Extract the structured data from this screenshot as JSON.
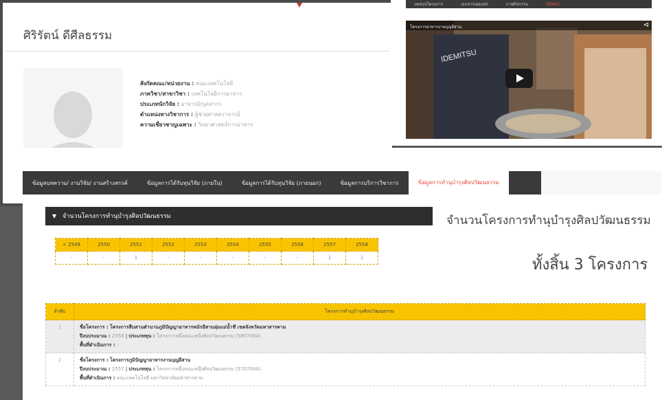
{
  "profile": {
    "name": "ศิริรัตน์ ดีศีลธรรม",
    "fields": [
      {
        "label": "สังกัดคณะ/หน่วยงาน :",
        "value": "คณะเทคโนโลยี"
      },
      {
        "label": "ภาควิชา/สาขาวิชา :",
        "value": "เทคโนโลยีการอาหาร"
      },
      {
        "label": "ประเภทนักวิจัย :",
        "value": "อาจารย์/บุคลากร"
      },
      {
        "label": "ตำแหน่งทางวิชาการ :",
        "value": "ผู้ช่วยศาสตราจารย์"
      },
      {
        "label": "ความเชี่ยวชาญเฉพาะ :",
        "value": "วิทยาศาสตร์การอาหาร"
      }
    ]
  },
  "topnav": {
    "items": [
      "บทสรุปโครงการ",
      "เอกสารเผยแพร่",
      "ภาพกิจกรรม",
      "วิดีทัศน์"
    ]
  },
  "video": {
    "title": "โครงการอาหารงานบุญอีสาน",
    "brand_text": "IDEMITSU"
  },
  "tabs": [
    "ข้อมูลบทความ/ งานวิจัย/ งานสร้างสรรค์",
    "ข้อมูลการได้รับทุนวิจัย (ภายใน)",
    "ข้อมูลการได้รับทุนวิจัย (ภายนอก)",
    "ข้อมูลการบริการวิชาการ",
    "ข้อมูลการทำนุบำรุงศิลปวัฒนธรรม"
  ],
  "accordion_title": "จำนวนโครงการทำนุบำรุงศิลปวัฒนธรรม",
  "years": [
    "< 2549",
    "2550",
    "2551",
    "2552",
    "2553",
    "2554",
    "2555",
    "2556",
    "2557",
    "2558"
  ],
  "year_counts": [
    "-",
    "-",
    "1",
    "-",
    "-",
    "-",
    "-",
    "-",
    "1",
    "1"
  ],
  "summary": {
    "title": "จำนวนโครงการทำนุบำรุงศิลปวัฒนธรรม",
    "count_text": "ทั้งสิ้น 3 โครงการ"
  },
  "projects_table": {
    "col_no": "ลำดับ",
    "col_title": "โครงการทำนุบำรุงศิลปวัฒนธรรม",
    "label_name": "ชื่อโครงการ :",
    "label_year": "ปีงบประมาณ :",
    "label_fund": "ประเภททุน :",
    "label_area": "พื้นที่ดำเนินการ :",
    "rows": [
      {
        "no": "1",
        "name": "โครงการสืบสานตำนานภูมิปัญญาอาหารหมักอีสานลุ่มแม่น้ำชี เขตจังหวัดมหาสารคาม",
        "year": "2558",
        "fund": "โครงการหนึ่งคณะหนึ่งศิลปวัฒนธรรม (5807004)",
        "area": "-"
      },
      {
        "no": "2",
        "name": "โครงการภูมิปัญญาอาหารงานบุญอีสาน",
        "year": "2557",
        "fund": "โครงการหนึ่งคณะหนึ่งศิลปวัฒนธรรม (5707004)",
        "area": "คณะเทคโนโลยี มหาวิทยาลัยมหาสารคาม"
      }
    ]
  }
}
